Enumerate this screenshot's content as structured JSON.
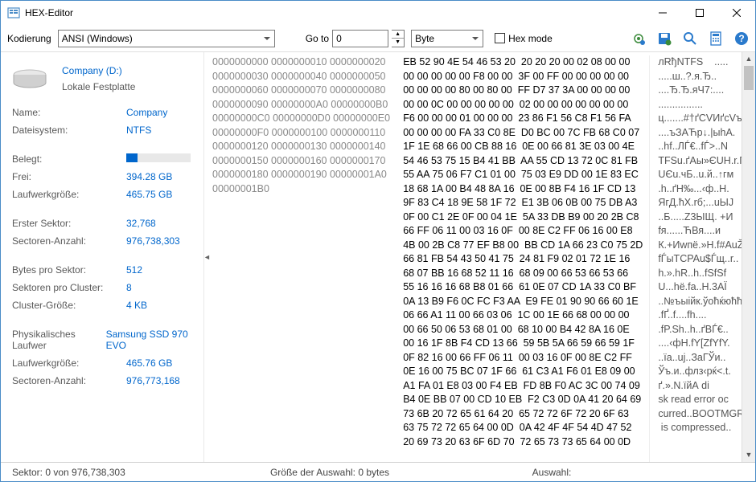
{
  "window": {
    "title": "HEX-Editor"
  },
  "toolbar": {
    "encoding_label": "Kodierung",
    "encoding_value": "ANSI (Windows)",
    "goto_label": "Go to",
    "goto_value": "0",
    "unit_value": "Byte",
    "hexmode_label": "Hex mode"
  },
  "disk": {
    "header_name": "Company (D:)",
    "header_type": "Lokale Festplatte",
    "groups": [
      [
        {
          "label": "Name:",
          "value": "Company"
        },
        {
          "label": "Dateisystem:",
          "value": "NTFS"
        }
      ],
      [
        {
          "label": "Belegt:",
          "bar": 18
        },
        {
          "label": "Frei:",
          "value": "394.28 GB"
        },
        {
          "label": "Laufwerkgröße:",
          "value": "465.75 GB"
        }
      ],
      [
        {
          "label": "Erster Sektor:",
          "value": "32,768"
        },
        {
          "label": "Sectoren-Anzahl:",
          "value": "976,738,303"
        }
      ],
      [
        {
          "label": "Bytes pro Sektor:",
          "value": "512"
        },
        {
          "label": "Sektoren pro Cluster:",
          "value": "8"
        },
        {
          "label": "Cluster-Größe:",
          "value": "4 KB"
        }
      ],
      [
        {
          "label": "Physikalisches Laufwer",
          "value": "Samsung SSD 970 EVO"
        },
        {
          "label": "Laufwerkgröße:",
          "value": "465.76 GB"
        },
        {
          "label": "Sectoren-Anzahl:",
          "value": "976,773,168"
        }
      ]
    ]
  },
  "hex": {
    "offsets": [
      "0000000000",
      "0000000010",
      "0000000020",
      "0000000030",
      "0000000040",
      "0000000050",
      "0000000060",
      "0000000070",
      "0000000080",
      "0000000090",
      "00000000A0",
      "00000000B0",
      "00000000C0",
      "00000000D0",
      "00000000E0",
      "00000000F0",
      "0000000100",
      "0000000110",
      "0000000120",
      "0000000130",
      "0000000140",
      "0000000150",
      "0000000160",
      "0000000170",
      "0000000180",
      "0000000190",
      "00000001A0",
      "00000001B0"
    ],
    "bytes": [
      "EB 52 90 4E 54 46 53 20  20 20 20 00 02 08 00 00",
      "00 00 00 00 00 F8 00 00  3F 00 FF 00 00 00 00 00",
      "00 00 00 00 80 00 80 00  FF D7 37 3A 00 00 00 00",
      "00 00 0C 00 00 00 00 00  02 00 00 00 00 00 00 00",
      "F6 00 00 00 01 00 00 00  23 86 F1 56 C8 F1 56 FA",
      "00 00 00 00 FA 33 C0 8E  D0 BC 00 7C FB 68 C0 07",
      "1F 1E 68 66 00 CB 88 16  0E 00 66 81 3E 03 00 4E",
      "54 46 53 75 15 B4 41 BB  AA 55 CD 13 72 0C 81 FB",
      "55 AA 75 06 F7 C1 01 00  75 03 E9 DD 00 1E 83 EC",
      "18 68 1A 00 B4 48 8A 16  0E 00 8B F4 16 1F CD 13",
      "9F 83 C4 18 9E 58 1F 72  E1 3B 06 0B 00 75 DB A3",
      "0F 00 C1 2E 0F 00 04 1E  5A 33 DB B9 00 20 2B C8",
      "66 FF 06 11 00 03 16 0F  00 8E C2 FF 06 16 00 E8",
      "4B 00 2B C8 77 EF B8 00  BB CD 1A 66 23 C0 75 2D",
      "66 81 FB 54 43 50 41 75  24 81 F9 02 01 72 1E 16",
      "68 07 BB 16 68 52 11 16  68 09 00 66 53 66 53 66",
      "55 16 16 16 68 B8 01 66  61 0E 07 CD 1A 33 C0 BF",
      "0A 13 B9 F6 0C FC F3 AA  E9 FE 01 90 90 66 60 1E",
      "06 66 A1 11 00 66 03 06  1C 00 1E 66 68 00 00 00",
      "00 66 50 06 53 68 01 00  68 10 00 B4 42 8A 16 0E",
      "00 16 1F 8B F4 CD 13 66  59 5B 5A 66 59 66 59 1F",
      "0F 82 16 00 66 FF 06 11  00 03 16 0F 00 8E C2 FF",
      "0E 16 00 75 BC 07 1F 66  61 C3 A1 F6 01 E8 09 00",
      "A1 FA 01 E8 03 00 F4 EB  FD 8B F0 AC 3C 00 74 09",
      "B4 0E BB 07 00 CD 10 EB  F2 C3 0D 0A 41 20 64 69",
      "73 6B 20 72 65 61 64 20  65 72 72 6F 72 20 6F 63",
      "63 75 72 72 65 64 00 0D  0A 42 4F 4F 54 4D 47 52",
      "20 69 73 20 63 6F 6D 70  72 65 73 73 65 64 00 0D"
    ],
    "ascii": [
      "лRђNTFS    .....",
      ".....ш..?.я.Ђ..",
      "....Ђ.Ђ.яЧ7:....",
      "................",
      "ц.......#†ґСVИґсVъ",
      "....ъЗАЋр↓.|ыhА.",
      "..hf..ЛЃ€..fЃ>..N",
      "TFSu.ґAы»ЄUН.r.Ѓы",
      "UЄu.чБ..u.й..↑гм",
      ".h..ґH‰...‹ф..Н.",
      "ЯгД.ћX.rб;...uЫЈ",
      "..Б.....Z3ЫЩ. +И",
      "fя......ЋВя....и",
      "К.+Иwпё.»Н.f#АuŽ",
      "fЃыTCPAu$Ѓщ..r..",
      "h.».hR..h..fSfSf",
      "U...hё.fa..Н.3АЇ",
      "..№ъыійк.ўоћќюћћ.",
      ".fҐ..f....fh....",
      ".fP.Sh..h..ґBЃ€..",
      "....‹фН.fY[ZfYfY.",
      "..їа..uj..ЗаГЎи..",
      "Ўъ.и..флз‹рќ<.t.",
      "ґ.».N.їйА di",
      "sk read error oc",
      "curred..BOOTMGR",
      " is compressed.."
    ]
  },
  "status": {
    "sector": "Sektor: 0 von 976,738,303",
    "selection": "Größe der Auswahl: 0 bytes",
    "auswahl": "Auswahl:"
  }
}
